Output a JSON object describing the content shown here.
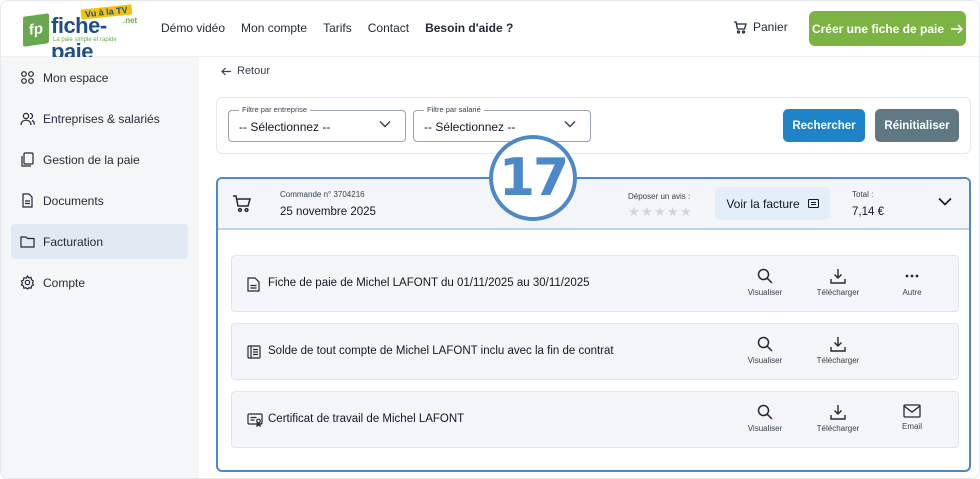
{
  "header": {
    "logo": {
      "brand": "fiche-paie",
      "badge": "Vu à la TV",
      "suffix": ".net",
      "tagline": "La paie simple et rapide",
      "mark": "fp"
    },
    "nav": [
      {
        "label": "Démo vidéo"
      },
      {
        "label": "Mon compte"
      },
      {
        "label": "Tarifs"
      },
      {
        "label": "Contact"
      },
      {
        "label": "Besoin d'aide ?"
      }
    ],
    "cart_label": "Panier",
    "cta_label": "Créer une fiche de paie"
  },
  "sidebar": {
    "items": [
      {
        "label": "Mon espace",
        "icon": "grid-icon"
      },
      {
        "label": "Entreprises & salariés",
        "icon": "users-icon"
      },
      {
        "label": "Gestion de la paie",
        "icon": "documents-icon"
      },
      {
        "label": "Documents",
        "icon": "file-icon"
      },
      {
        "label": "Facturation",
        "icon": "folder-icon",
        "active": true
      },
      {
        "label": "Compte",
        "icon": "gear-icon"
      }
    ]
  },
  "main": {
    "back_label": "Retour",
    "filters": {
      "company_label": "Filtre par entreprise",
      "company_value": "-- Sélectionnez --",
      "employee_label": "Filtre par salarié",
      "employee_value": "-- Sélectionnez --",
      "search_label": "Rechercher",
      "reset_label": "Réinitialiser"
    },
    "annotation_badge": "17",
    "order": {
      "number": "Commande n° 3704216",
      "date": "25 novembre 2025",
      "review_label": "Déposer un avis :",
      "stars": 5,
      "invoice_label": "Voir la facture",
      "total_label": "Total :",
      "total_value": "7,14 €",
      "documents": [
        {
          "label": "Fiche de paie de Michel LAFONT du 01/11/2025 au 30/11/2025",
          "icon": "file-icon",
          "actions": [
            "Visualiser",
            "Télécharger",
            "Autre"
          ]
        },
        {
          "label": "Solde de tout compte de Michel LAFONT inclu avec la fin de contrat",
          "icon": "ledger-icon",
          "actions": [
            "Visualiser",
            "Télécharger"
          ]
        },
        {
          "label": "Certificat de travail de Michel LAFONT",
          "icon": "certificate-icon",
          "actions": [
            "Visualiser",
            "Télécharger",
            "Email"
          ]
        }
      ]
    }
  },
  "colors": {
    "accent": "#4d88c9",
    "cta": "#7cb342",
    "search": "#1f84c7",
    "reset": "#5f7882"
  }
}
